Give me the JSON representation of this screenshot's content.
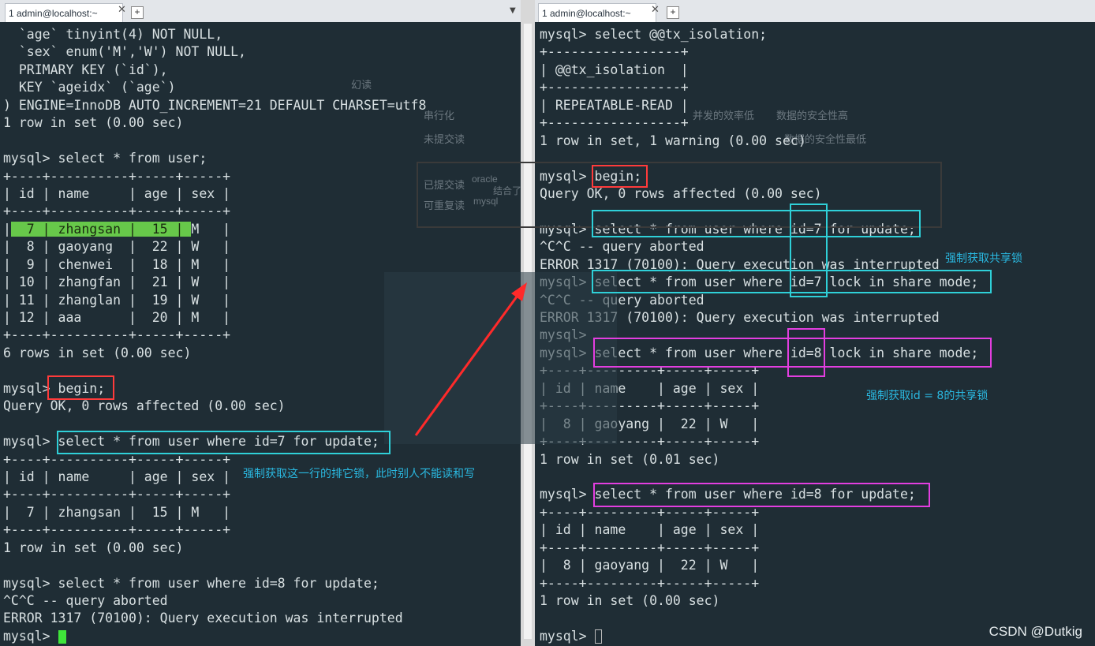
{
  "tabs": {
    "left": {
      "label": "1 admin@localhost:~",
      "close": "✕",
      "add": "+"
    },
    "right": {
      "label": "1 admin@localhost:~",
      "close": "✕",
      "add": "+"
    }
  },
  "background_ghost": {
    "items": [
      "串行化",
      "未提交读",
      "已提交读",
      "可重复读",
      "oracle",
      "mysql",
      "幻读",
      "并发的效率低",
      "数据的安全性高",
      "数据的安全性最低",
      "结合了"
    ]
  },
  "left_terminal": {
    "lines": [
      "  `age` tinyint(4) NOT NULL,",
      "  `sex` enum('M','W') NOT NULL,",
      "  PRIMARY KEY (`id`),",
      "  KEY `ageidx` (`age`)",
      ") ENGINE=InnoDB AUTO_INCREMENT=21 DEFAULT CHARSET=utf8",
      "1 row in set (0.00 sec)",
      "",
      "mysql> select * from user;",
      "+----+----------+-----+-----+",
      "| id | name     | age | sex |",
      "+----+----------+-----+-----+",
      "|  7 | zhangsan |  15 | M   |",
      "|  8 | gaoyang  |  22 | W   |",
      "|  9 | chenwei  |  18 | M   |",
      "| 10 | zhangfan |  21 | W   |",
      "| 11 | zhanglan |  19 | W   |",
      "| 12 | aaa      |  20 | M   |",
      "+----+----------+-----+-----+",
      "6 rows in set (0.00 sec)",
      "",
      "mysql> begin;",
      "Query OK, 0 rows affected (0.00 sec)",
      "",
      "mysql> select * from user where id=7 for update;",
      "+----+----------+-----+-----+",
      "| id | name     | age | sex |",
      "+----+----------+-----+-----+",
      "|  7 | zhangsan |  15 | M   |",
      "+----+----------+-----+-----+",
      "1 row in set (0.00 sec)",
      "",
      "mysql> select * from user where id=8 for update;",
      "^C^C -- query aborted",
      "ERROR 1317 (70100): Query execution was interrupted",
      "mysql> "
    ],
    "highlight_row_text": "  7 | zhangsan |  15 | "
  },
  "right_terminal": {
    "lines": [
      "mysql> select @@tx_isolation;",
      "+-----------------+",
      "| @@tx_isolation  |",
      "+-----------------+",
      "| REPEATABLE-READ |",
      "+-----------------+",
      "1 row in set, 1 warning (0.00 sec)",
      "",
      "mysql> begin;",
      "Query OK, 0 rows affected (0.00 sec)",
      "",
      "mysql> select * from user where id=7 for update;",
      "^C^C -- query aborted",
      "ERROR 1317 (70100): Query execution was interrupted",
      "mysql> select * from user where id=7 lock in share mode;",
      "^C^C -- query aborted",
      "ERROR 1317 (70100): Query execution was interrupted",
      "mysql>",
      "mysql> select * from user where id=8 lock in share mode;",
      "+----+---------+-----+-----+",
      "| id | name    | age | sex |",
      "+----+---------+-----+-----+",
      "|  8 | gaoyang |  22 | W   |",
      "+----+---------+-----+-----+",
      "1 row in set (0.01 sec)",
      "",
      "mysql> select * from user where id=8 for update;",
      "+----+---------+-----+-----+",
      "| id | name    | age | sex |",
      "+----+---------+-----+-----+",
      "|  8 | gaoyang |  22 | W   |",
      "+----+---------+-----+-----+",
      "1 row in set (0.00 sec)",
      "",
      "mysql> "
    ]
  },
  "annotations": {
    "left_note": "强制获取这一行的排它锁，此时别人不能读和写",
    "right_note_1": "强制获取共享锁",
    "right_note_2": "强制获取id = 8的共享锁"
  },
  "watermark": "CSDN @Dutkig",
  "colors": {
    "terminal_bg": "#1f2d35",
    "terminal_text": "#d8e0e2",
    "box_red": "#ff3b3b",
    "box_cyan": "#2fd0d8",
    "box_magenta": "#e33ee0",
    "note_blue": "#2ab8e0",
    "row_highlight": "#67c84a",
    "cursor_green": "#3fe53a",
    "arrow": "#ff2a2a"
  }
}
